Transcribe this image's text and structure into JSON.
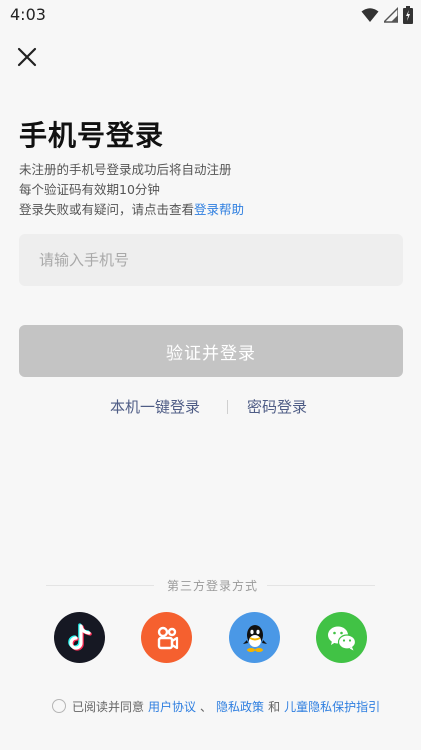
{
  "status": {
    "time": "4:03",
    "icons": [
      "wifi-icon",
      "signal-icon",
      "battery-icon"
    ]
  },
  "header": {
    "close_icon": "close-icon"
  },
  "title": "手机号登录",
  "hints": {
    "line1": "未注册的手机号登录成功后将自动注册",
    "line2": "每个验证码有效期10分钟",
    "line3_prefix": "登录失败或有疑问，请点击查看",
    "line3_link": "登录帮助"
  },
  "phone": {
    "placeholder": "请输入手机号",
    "value": ""
  },
  "login_button": {
    "label": "验证并登录",
    "state": "disabled"
  },
  "alt": {
    "one_click": "本机一键登录",
    "password": "密码登录"
  },
  "third_party": {
    "label": "第三方登录方式",
    "providers": [
      {
        "name": "tiktok-login",
        "color": "#161823"
      },
      {
        "name": "kuaishou-login",
        "color": "#f5602f"
      },
      {
        "name": "qq-login",
        "color": "#4a98e6"
      },
      {
        "name": "wechat-login",
        "color": "#41c245"
      }
    ]
  },
  "agreement": {
    "prefix": "已阅读并同意",
    "user_agreement": "用户协议",
    "sep": "、",
    "privacy": "隐私政策",
    "and": "和",
    "child_privacy": "儿童隐私保护指引",
    "checked": false
  },
  "colors": {
    "link": "#2f7fe0",
    "alt_link": "#4f5d86",
    "button_disabled": "#c4c4c4",
    "input_bg": "#eeeeee"
  }
}
